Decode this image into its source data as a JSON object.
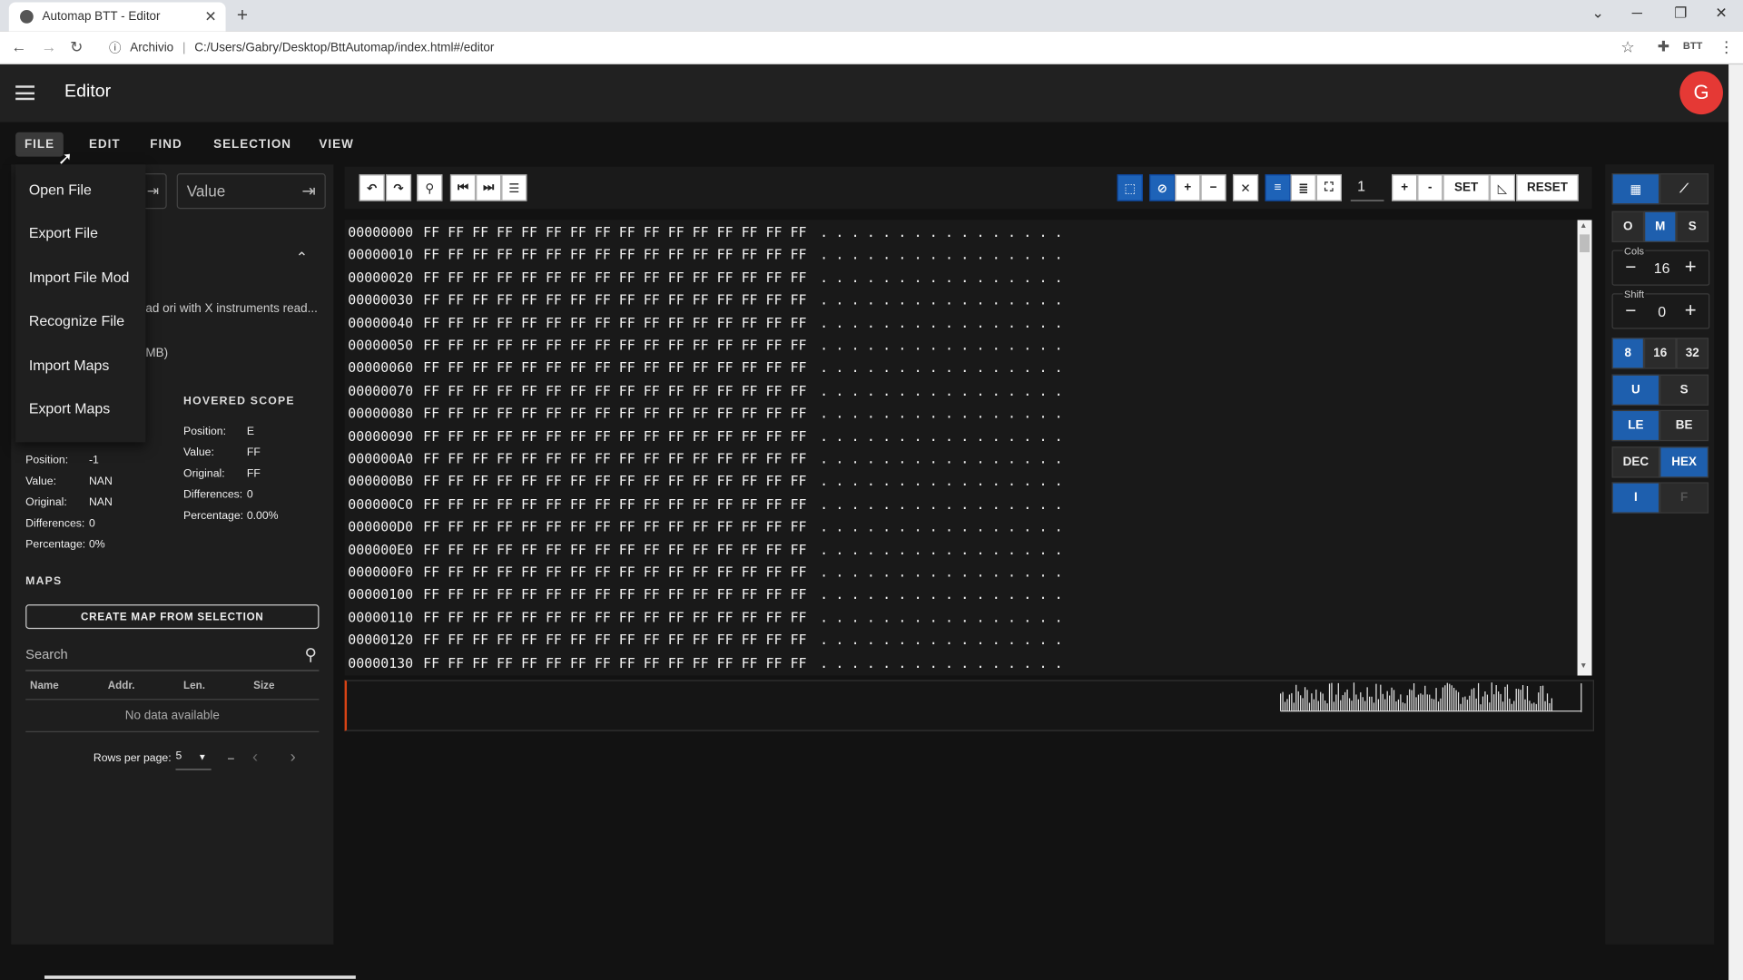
{
  "browser": {
    "tab_title": "Automap BTT - Editor",
    "url_scheme": "Archivio",
    "url": "C:/Users/Gabry/Desktop/BttAutomap/index.html#/editor",
    "extension_label": "BTT"
  },
  "appbar": {
    "title": "Editor",
    "avatar_letter": "G"
  },
  "menubar": {
    "file": "FILE",
    "edit": "EDIT",
    "find": "FIND",
    "selection": "SELECTION",
    "view": "VIEW"
  },
  "file_menu": [
    "Open File",
    "Export File",
    "Import File Mod",
    "Recognize File",
    "Import Maps",
    "Export Maps"
  ],
  "left": {
    "value_placeholder": "Value",
    "fragment_desc": "ad ori with X instruments read...",
    "fragment_size": "MB)",
    "hovered_scope_title": "HOVERED SCOPE",
    "hovered": {
      "position_label": "Position:",
      "position": "E",
      "value_label": "Value:",
      "value": "FF",
      "original_label": "Original:",
      "original": "FF",
      "differences_label": "Differences:",
      "differences": "0",
      "percentage_label": "Percentage:",
      "percentage": "0.00%"
    },
    "selected": {
      "position_label": "Position:",
      "position": "-1",
      "value_label": "Value:",
      "value": "NAN",
      "original_label": "Original:",
      "original": "NAN",
      "differences_label": "Differences:",
      "differences": "0",
      "percentage_label": "Percentage:",
      "percentage": "0%"
    },
    "maps_title": "MAPS",
    "create_map_button": "CREATE MAP FROM SELECTION",
    "search_placeholder": "Search",
    "table_headers": [
      "Name",
      "Addr.",
      "Len.",
      "Size"
    ],
    "no_data": "No data available",
    "rows_per_page_label": "Rows per page:",
    "rows_per_page": "5",
    "page_range": "–"
  },
  "toolbar": {
    "step_value": "1",
    "plus": "+",
    "minus": "-",
    "set": "SET",
    "reset": "RESET"
  },
  "hex": {
    "bytes": "FF FF FF FF FF FF FF FF FF FF FF FF FF FF FF FF",
    "ascii": ". . . . . . . . . . . . . . . .",
    "offsets": [
      "00000000",
      "00000010",
      "00000020",
      "00000030",
      "00000040",
      "00000050",
      "00000060",
      "00000070",
      "00000080",
      "00000090",
      "000000A0",
      "000000B0",
      "000000C0",
      "000000D0",
      "000000E0",
      "000000F0",
      "00000100",
      "00000110",
      "00000120",
      "00000130"
    ]
  },
  "right": {
    "oms": [
      "O",
      "M",
      "S"
    ],
    "cols_label": "Cols",
    "cols": "16",
    "shift_label": "Shift",
    "shift": "0",
    "bits": [
      "8",
      "16",
      "32"
    ],
    "sign": [
      "U",
      "S"
    ],
    "endian": [
      "LE",
      "BE"
    ],
    "base": [
      "DEC",
      "HEX"
    ],
    "type": [
      "I",
      "F"
    ]
  }
}
